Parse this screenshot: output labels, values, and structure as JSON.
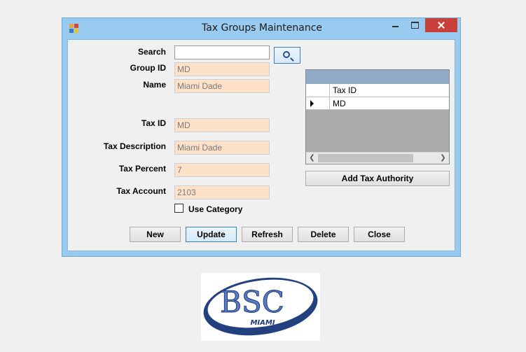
{
  "window": {
    "title": "Tax Groups Maintenance",
    "icon": "app-icon",
    "controls": [
      "minimize-icon",
      "maximize-icon",
      "close-icon"
    ]
  },
  "form": {
    "search": {
      "label": "Search",
      "value": "",
      "button_icon": "search-icon"
    },
    "group_id": {
      "label": "Group ID",
      "value": "MD"
    },
    "name": {
      "label": "Name",
      "value": "Miami Dade"
    },
    "tax_id": {
      "label": "Tax ID",
      "value": "MD"
    },
    "tax_description": {
      "label": "Tax Description",
      "value": "Miami Dade"
    },
    "tax_percent": {
      "label": "Tax Percent",
      "value": "7"
    },
    "tax_account": {
      "label": "Tax Account",
      "value": "2103"
    },
    "use_category": {
      "label": "Use Category",
      "checked": false
    }
  },
  "grid": {
    "columns": [
      "Tax ID"
    ],
    "rows": [
      [
        "MD"
      ]
    ],
    "selected_row": 0
  },
  "buttons": {
    "add_tax_authority": "Add Tax Authority",
    "new": "New",
    "update": "Update",
    "refresh": "Refresh",
    "delete": "Delete",
    "close": "Close"
  },
  "logo": {
    "text": "BSC",
    "subtext": "MIAMI"
  },
  "colors": {
    "titlebar": "#99cbf1",
    "readonly_field": "#fde1c8",
    "close_button": "#c7403a",
    "grid_background": "#ababab",
    "logo_blue": "#2a4a8f"
  }
}
